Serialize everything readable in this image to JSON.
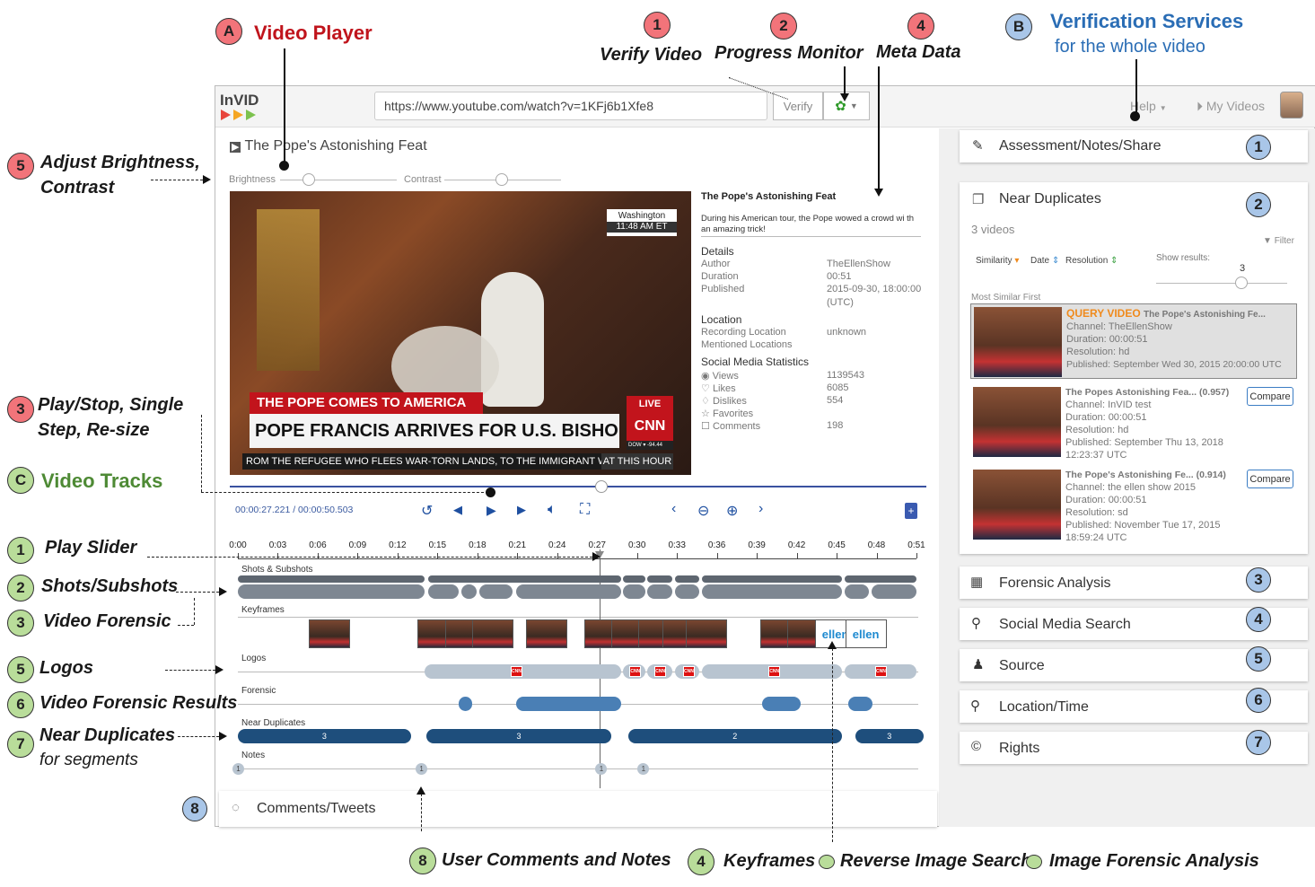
{
  "app": {
    "logo": "InVID",
    "url": "https://www.youtube.com/watch?v=1KFj6b1Xfe8",
    "verify_label": "Verify",
    "help_label": "Help",
    "my_videos_label": "My Videos"
  },
  "player": {
    "title": "The Pope's Astonishing Feat",
    "brightness_label": "Brightness",
    "contrast_label": "Contrast",
    "time_readout": "00:00:27.221 / 00:00:50.503",
    "overlay": {
      "location": "Washington",
      "time": "11:48 AM ET",
      "banner_top": "THE POPE COMES TO AMERICA",
      "live": "LIVE",
      "headline": "POPE FRANCIS ARRIVES FOR U.S. BISHOPS' MEETING",
      "network": "CNN",
      "dow": "DOW ▾ -94.44",
      "ticker": "ROM THE REFUGEE WHO FLEES WAR-TORN LANDS, TO THE IMMIGRANT WHO",
      "at_this_hour": "AT THIS HOUR"
    }
  },
  "meta": {
    "title": "The Pope's Astonishing Feat",
    "desc": "During his American tour, the Pope wowed a crowd wi th an amazing trick!",
    "details_h": "Details",
    "author_k": "Author",
    "author_v": "TheEllenShow",
    "duration_k": "Duration",
    "duration_v": "00:51",
    "published_k": "Published",
    "published_v": "2015-09-30, 18:00:00",
    "published_tz": "(UTC)",
    "location_h": "Location",
    "rec_loc_k": "Recording Location",
    "rec_loc_v": "unknown",
    "mentioned_k": "Mentioned Locations",
    "stats_h": "Social Media Statistics",
    "views_k": "Views",
    "views_v": "1139543",
    "likes_k": "Likes",
    "likes_v": "6085",
    "dislikes_k": "Dislikes",
    "dislikes_v": "554",
    "favorites_k": "Favorites",
    "comments_k": "Comments",
    "comments_v": "198"
  },
  "timeline": {
    "ticks": [
      "0:00",
      "0:03",
      "0:06",
      "0:09",
      "0:12",
      "0:15",
      "0:18",
      "0:21",
      "0:24",
      "0:27",
      "0:30",
      "0:33",
      "0:36",
      "0:39",
      "0:42",
      "0:45",
      "0:48",
      "0:51"
    ],
    "shots_label": "Shots & Subshots",
    "keyframes_label": "Keyframes",
    "logos_label": "Logos",
    "logo_text": "CNN",
    "forensic_label": "Forensic",
    "neardup_label": "Near Duplicates",
    "neardup_counts": [
      "3",
      "3",
      "2",
      "3"
    ],
    "notes_label": "Notes",
    "note_count": "1",
    "keyframe_logo": "ellen",
    "play_position": 0.533
  },
  "sidebar": {
    "assessment": "Assessment/Notes/Share",
    "near_dup": "Near Duplicates",
    "count": "3 videos",
    "filter": "Filter",
    "sort_similarity": "Similarity",
    "sort_date": "Date",
    "sort_resolution": "Resolution",
    "show_results": "Show results:",
    "show_results_value": "3",
    "most_similar": "Most Similar First",
    "compare": "Compare",
    "results": [
      {
        "tag": "QUERY VIDEO",
        "title": "The Pope's Astonishing Fe...",
        "channel": "Channel: TheEllenShow",
        "duration": "Duration: 00:00:51",
        "resolution": "Resolution: hd",
        "published": "Published: September Wed 30, 2015 20:00:00 UTC",
        "published2": ""
      },
      {
        "tag": "",
        "title": "The Popes Astonishing Fea... (0.957)",
        "channel": "Channel: InVID test",
        "duration": "Duration: 00:00:51",
        "resolution": "Resolution: hd",
        "published": "Published: September Thu 13, 2018",
        "published2": "12:23:37 UTC"
      },
      {
        "tag": "",
        "title": "The Pope's Astonishing Fe... (0.914)",
        "channel": "Channel: the ellen show 2015",
        "duration": "Duration: 00:00:51",
        "resolution": "Resolution: sd",
        "published": "Published: November Tue 17, 2015",
        "published2": "18:59:24 UTC"
      }
    ],
    "forensic": "Forensic Analysis",
    "social": "Social Media Search",
    "source": "Source",
    "loctime": "Location/Time",
    "rights": "Rights",
    "comments": "Comments/Tweets"
  },
  "annotations": {
    "A": "A",
    "A_label": "Video Player",
    "B": "B",
    "B_label1": "Verification Services",
    "B_label2": "for the whole video",
    "C": "C",
    "C_label": "Video Tracks",
    "n1": "1",
    "verify_video": "Verify Video",
    "n2": "2",
    "progress_monitor": "Progress Monitor",
    "n4": "4",
    "meta_data": "Meta Data",
    "n5": "5",
    "adjust1": "Adjust Brightness,",
    "adjust2": "Contrast",
    "n3": "3",
    "play1": "Play/Stop, Single",
    "play2": "Step, Re-size",
    "t1": "1",
    "play_slider": "Play Slider",
    "t2": "2",
    "shots": "Shots/Subshots",
    "t3": "3",
    "video_forensic": "Video Forensic",
    "t5": "5",
    "logos": "Logos",
    "t6": "6",
    "vf_results": "Video Forensic Results",
    "t7": "7",
    "near1": "Near Duplicates",
    "near2": "for segments",
    "s1": "1",
    "s2": "2",
    "s3": "3",
    "s4": "4",
    "s5": "5",
    "s6": "6",
    "s7": "7",
    "s8": "8",
    "b8": "8",
    "user_comments": "User Comments and Notes",
    "b4": "4",
    "keyframes": "Keyframes",
    "reverse": "Reverse Image Search",
    "image_forensic": "Image Forensic Analysis"
  },
  "colors": {
    "red": "#c0141c",
    "blue": "#2a6db5",
    "green": "#4e8a35",
    "track_dark": "#1e4e7c",
    "track_mid": "#4a7fb5",
    "track_light": "#b8c4d0",
    "shots_dark": "#5e6670",
    "shots_light": "#7e8792",
    "query_orange": "#f08a1c"
  }
}
